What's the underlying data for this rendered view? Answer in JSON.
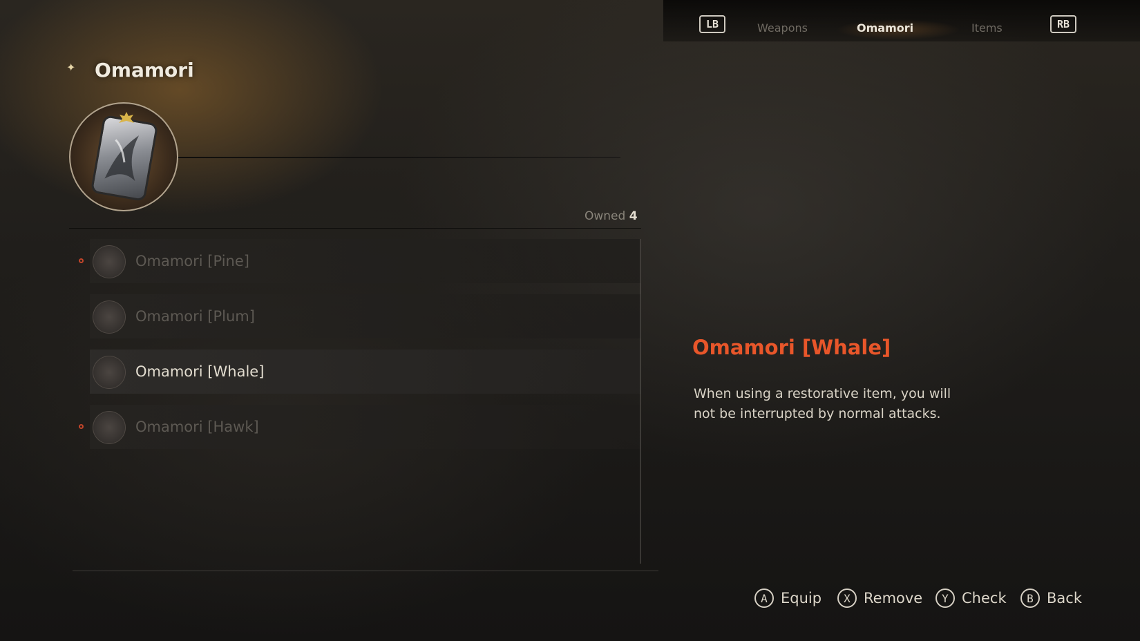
{
  "tabs": {
    "left_bumper": "LB",
    "right_bumper": "RB",
    "items": [
      {
        "label": "Weapons",
        "active": false
      },
      {
        "label": "Omamori",
        "active": true
      },
      {
        "label": "Items",
        "active": false
      }
    ]
  },
  "header": {
    "title": "Omamori"
  },
  "inventory": {
    "owned_label": "Owned",
    "owned_count": "4"
  },
  "list": {
    "items": [
      {
        "label": "Omamori [Pine]",
        "marker": true,
        "selected": false
      },
      {
        "label": "Omamori [Plum]",
        "marker": false,
        "selected": false
      },
      {
        "label": "Omamori [Whale]",
        "marker": false,
        "selected": true
      },
      {
        "label": "Omamori [Hawk]",
        "marker": true,
        "selected": false
      }
    ]
  },
  "detail": {
    "title": "Omamori [Whale]",
    "description": "When using a restorative item, you will not be interrupted by normal attacks."
  },
  "buttons": [
    {
      "face": "A",
      "label": "Equip"
    },
    {
      "face": "X",
      "label": "Remove"
    },
    {
      "face": "Y",
      "label": "Check"
    },
    {
      "face": "B",
      "label": "Back"
    }
  ],
  "colors": {
    "accent": "#e8562a",
    "marker": "#c2452a"
  }
}
